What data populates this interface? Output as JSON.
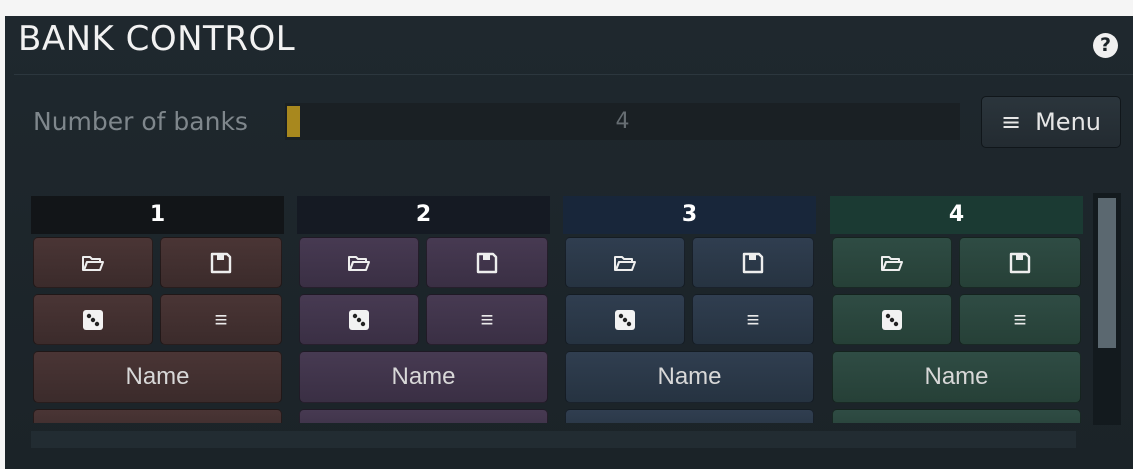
{
  "panel": {
    "title": "BANK CONTROL",
    "help_label": "?"
  },
  "number_of_banks": {
    "label": "Number of banks",
    "value": "4",
    "fill_fraction": 0.02,
    "fill_color": "#a8881e"
  },
  "menu": {
    "icon": "hamburger-icon",
    "icon_glyph": "≡",
    "label": "Menu"
  },
  "banks": [
    {
      "number": "1",
      "name_label": "Name",
      "color": "#4a3535",
      "header_color": "#121518",
      "load_icon": "folder-open-icon",
      "save_icon": "save-disk-icon",
      "random_icon": "dice-icon",
      "menu_icon": "hamburger-icon",
      "menu_glyph": "≡"
    },
    {
      "number": "2",
      "name_label": "Name",
      "color": "#473a52",
      "header_color": "#151a23",
      "load_icon": "folder-open-icon",
      "save_icon": "save-disk-icon",
      "random_icon": "dice-icon",
      "menu_icon": "hamburger-icon",
      "menu_glyph": "≡"
    },
    {
      "number": "3",
      "name_label": "Name",
      "color": "#303e50",
      "header_color": "#18263a",
      "load_icon": "folder-open-icon",
      "save_icon": "save-disk-icon",
      "random_icon": "dice-icon",
      "menu_icon": "hamburger-icon",
      "menu_glyph": "≡"
    },
    {
      "number": "4",
      "name_label": "Name",
      "color": "#2f4c44",
      "header_color": "#1b3a33",
      "load_icon": "folder-open-icon",
      "save_icon": "save-disk-icon",
      "random_icon": "dice-icon",
      "menu_icon": "hamburger-icon",
      "menu_glyph": "≡"
    }
  ],
  "colors": {
    "background": "#1f282e",
    "text": "#f2f2f2",
    "accent": "#a8881e"
  }
}
